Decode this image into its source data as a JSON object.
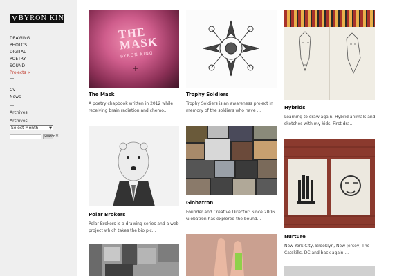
{
  "site": {
    "logo_mark": "V",
    "logo_text": "BYRON KING"
  },
  "nav": {
    "primary": [
      "DRAWING",
      "PHOTOS",
      "DIGITAL",
      "POETRY",
      "SOUND"
    ],
    "active": "Projects >",
    "secondary": [
      "CV",
      "News"
    ]
  },
  "archives": {
    "heading": "Archives",
    "label": "Archives",
    "select_value": "Select Month",
    "search_button": "Search",
    "clear_glyph": "✕"
  },
  "projects": [
    {
      "title": "The Mask",
      "description": "A poetry chapbook written in 2012 while receiving brain radiation and chemo...",
      "image_text": "THE MASK",
      "image_subtext": "BYRON KING"
    },
    {
      "title": "Trophy Soldiers",
      "description": "Trophy Soldiers is an awareness project in memory of the soldiers who have ..."
    },
    {
      "title": "Hybrids",
      "description": "Learning to draw again. Hybrid animals and sketches with my kids. First dra..."
    },
    {
      "title": "Polar Brokers",
      "description": "Polar Brokers is a drawing series and a web project which takes the bio pic..."
    },
    {
      "title": "Globatron",
      "description": "Founder and Creative Director: Since 2006, Globatron has explored the bound..."
    },
    {
      "title": "Nurture",
      "description": "New York City, Brooklyn, New Jersey, The Catskills, DC and back again...."
    }
  ],
  "colors": {
    "sidebar_bg": "#efefef",
    "active_link": "#c0392b",
    "text": "#222222"
  }
}
